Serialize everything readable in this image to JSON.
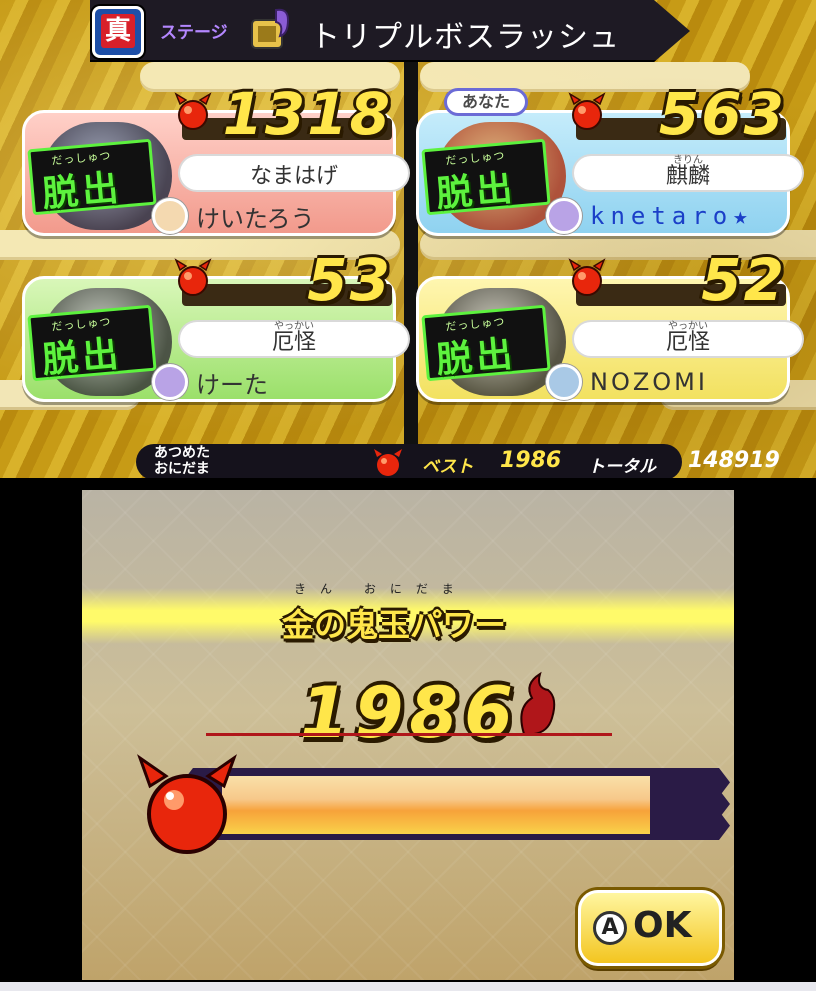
{
  "stage": {
    "badge": "真",
    "label": "ステージ",
    "name": "トリプルボスラッシュ"
  },
  "cards": [
    {
      "score": "1318",
      "escape_ruby": "だっしゅつ",
      "escape": "脱出",
      "yokai_ruby": "",
      "yokai": "なまはげ",
      "player": "けいたろう",
      "is_you": false
    },
    {
      "score": "563",
      "escape_ruby": "だっしゅつ",
      "escape": "脱出",
      "yokai_ruby": "きりん",
      "yokai": "麒麟",
      "player": "knetaro★",
      "is_you": true
    },
    {
      "score": "53",
      "escape_ruby": "だっしゅつ",
      "escape": "脱出",
      "yokai_ruby": "やっかい",
      "yokai": "厄怪",
      "player": "けーた",
      "is_you": false
    },
    {
      "score": "52",
      "escape_ruby": "だっしゅつ",
      "escape": "脱出",
      "yokai_ruby": "やっかい",
      "yokai": "厄怪",
      "player": "NOZOMI",
      "is_you": false
    }
  ],
  "you_badge": "あなた",
  "collected": {
    "label_line1": "あつめた",
    "label_line2": "おにだま",
    "best_label": "ベスト",
    "best_value": "1986",
    "total_label": "トータル",
    "total_value": "148919"
  },
  "result": {
    "title_ruby": "きん おにだま",
    "title": "金の鬼玉パワー",
    "value": "1986",
    "meter_fill": 1.0
  },
  "ok": {
    "a_key": "A",
    "label": "OK"
  },
  "colors": {
    "score_yellow": "#ffe64a",
    "escape_green": "#5df23e",
    "oni_red": "#e8260c"
  }
}
